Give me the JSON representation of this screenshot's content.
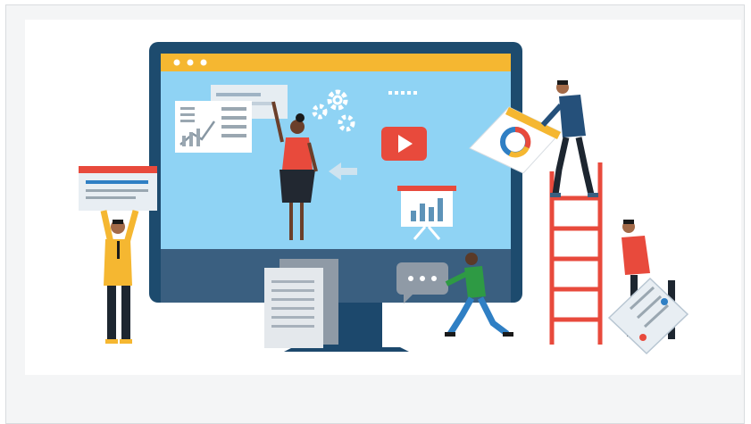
{
  "card": {
    "illustration_topic": "",
    "colors": {
      "monitor_frame": "#1d4b6e",
      "screen": "#8fd3f4",
      "accent_yellow": "#f5b731",
      "accent_red": "#e84a3c",
      "ladder": "#e84a3c",
      "stand": "#1c486c",
      "base": "#3a5f80",
      "card_bg": "#f4f5f6"
    },
    "icons": [
      "monitor-icon",
      "gear-icon",
      "play-button-icon",
      "bar-chart-icon",
      "pie-chart-icon",
      "chat-bubble-icon",
      "document-stack-icon",
      "checklist-icon",
      "arrow-left-icon",
      "ladder-icon"
    ]
  }
}
